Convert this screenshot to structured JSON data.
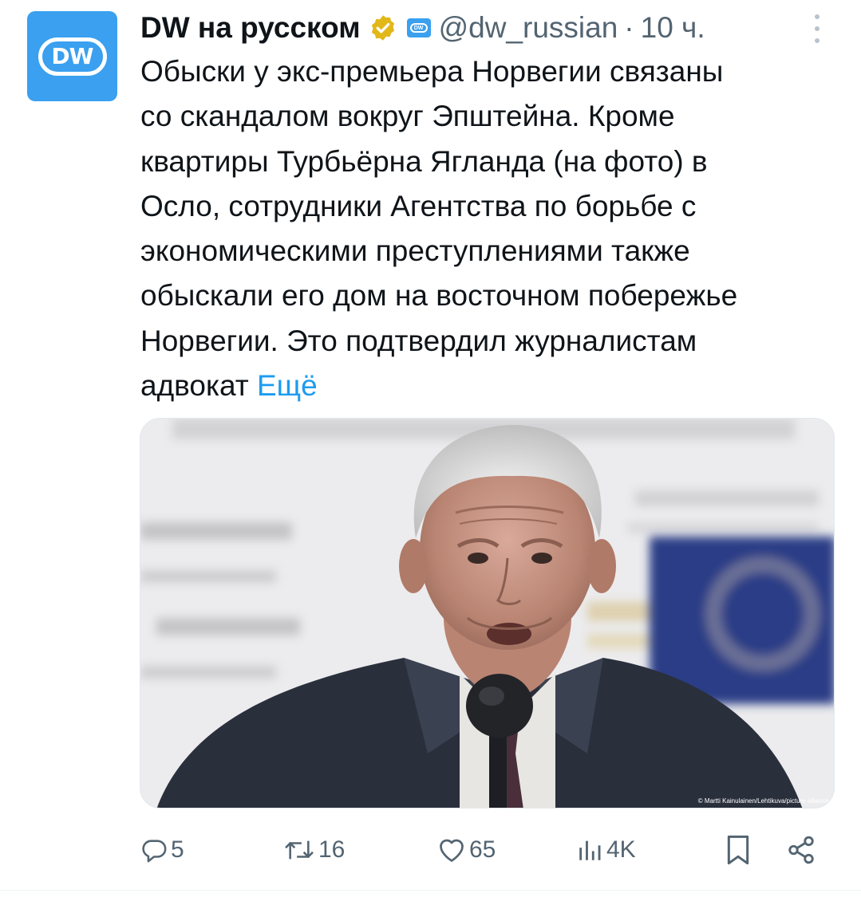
{
  "author": {
    "avatar_text": "DW",
    "display_name": "DW на русском",
    "handle": "@dw_russian",
    "separator": "·",
    "time": "10 ч."
  },
  "tweet": {
    "lines": [
      "Обыски у экс-премьера Норвегии связаны",
      "со скандалом вокруг Эпштейна. Кроме",
      "квартиры Турбьёрна Ягланда (на фото) в",
      "Осло, сотрудники Агентства по борьбе с",
      "экономическими преступлениями также",
      "обыскали его дом на восточном побережье",
      "Норвегии. Это подтвердил журналистам"
    ],
    "last_line": "адвокат",
    "more_label": "Ещё"
  },
  "media": {
    "credit": "© Martti Kainulainen/Lehtikuva/picture alliance"
  },
  "actions": {
    "replies": "5",
    "reposts": "16",
    "likes": "65",
    "views": "4K"
  },
  "colors": {
    "accent": "#1d9bf0",
    "muted": "#536471",
    "avatar_bg": "#3aa0ef",
    "verified": "#e2b719"
  },
  "icons": [
    "verified-badge-icon",
    "dw-affiliate-icon",
    "more-icon",
    "reply-icon",
    "repost-icon",
    "like-icon",
    "views-icon",
    "bookmark-icon",
    "share-icon"
  ]
}
